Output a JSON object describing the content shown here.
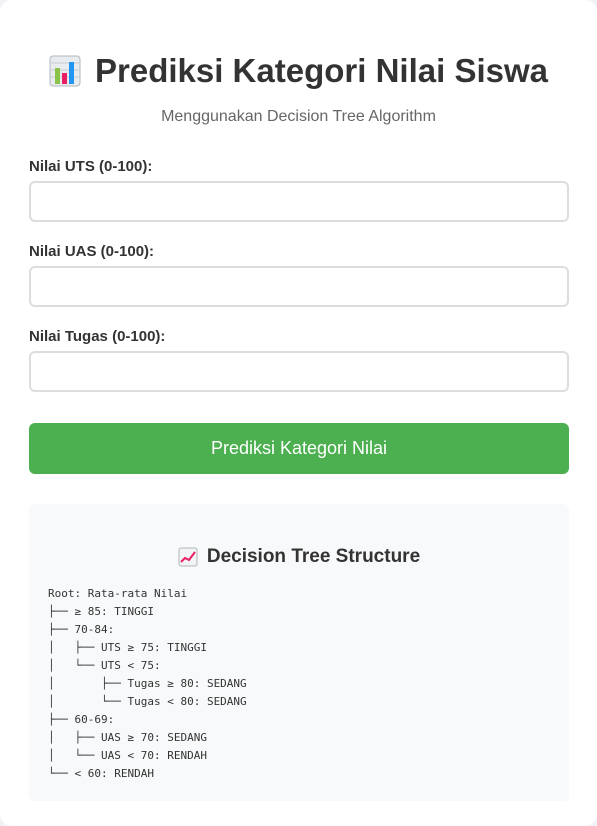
{
  "header": {
    "title_icon": "bar-chart-icon",
    "title": "Prediksi Kategori Nilai Siswa",
    "subtitle": "Menggunakan Decision Tree Algorithm"
  },
  "form": {
    "uts": {
      "label": "Nilai UTS (0-100):",
      "value": "",
      "placeholder": ""
    },
    "uas": {
      "label": "Nilai UAS (0-100):",
      "value": "",
      "placeholder": ""
    },
    "tugas": {
      "label": "Nilai Tugas (0-100):",
      "value": "",
      "placeholder": ""
    },
    "submit_label": "Prediksi Kategori Nilai"
  },
  "tree": {
    "title_icon": "line-chart-icon",
    "title": "Decision Tree Structure",
    "lines": [
      "Root: Rata-rata Nilai",
      "├── ≥ 85: TINGGI",
      "├── 70-84:",
      "│   ├── UTS ≥ 75: TINGGI",
      "│   └── UTS < 75:",
      "│       ├── Tugas ≥ 80: SEDANG",
      "│       └── Tugas < 80: SEDANG",
      "├── 60-69:",
      "│   ├── UAS ≥ 70: SEDANG",
      "│   └── UAS < 70: RENDAH",
      "└── < 60: RENDAH"
    ]
  },
  "colors": {
    "accent": "#4caf50",
    "panel": "#f8f9fa",
    "text": "#333333",
    "muted": "#666666"
  }
}
